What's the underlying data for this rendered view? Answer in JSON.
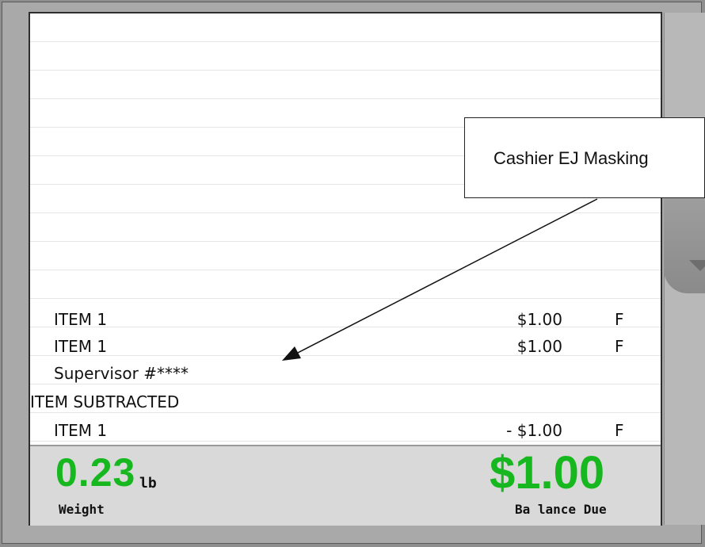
{
  "receipt": {
    "rows": [
      {
        "desc": "ITEM 1",
        "amount": "$1.00",
        "tax": "F"
      },
      {
        "desc": "ITEM 1",
        "amount": "$1.00",
        "tax": "F"
      },
      {
        "desc": "Supervisor #****",
        "amount": "",
        "tax": ""
      },
      {
        "desc": "ITEM SUBTRACTED",
        "amount": "",
        "tax": ""
      },
      {
        "desc": "ITEM 1",
        "amount": "- $1.00",
        "tax": "F"
      }
    ]
  },
  "status": {
    "weight_value": "0.23",
    "weight_unit": "lb",
    "weight_label": "Weight",
    "balance_value": "$1.00",
    "balance_label": "Ba lance Due"
  },
  "callout": {
    "text": "Cashier EJ Masking"
  },
  "scrollbar": {
    "icon": "chevron-down-icon"
  },
  "colors": {
    "amount_green": "#17b81f",
    "status_bg": "#d9d9d9"
  }
}
